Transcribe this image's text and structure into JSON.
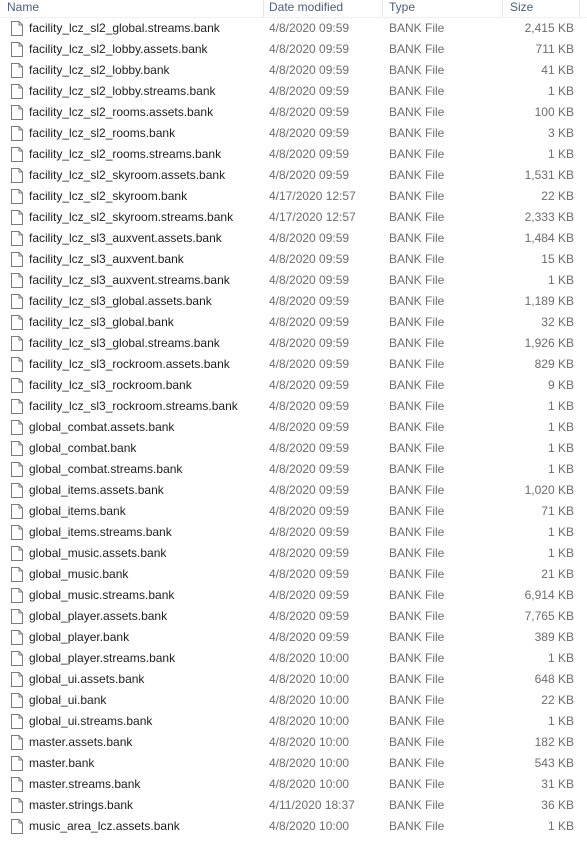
{
  "columns": {
    "name": "Name",
    "date": "Date modified",
    "type": "Type",
    "size": "Size"
  },
  "icons": {
    "file": "file-icon"
  },
  "files": [
    {
      "name": "facility_lcz_sl2_global.streams.bank",
      "date": "4/8/2020 09:59",
      "type": "BANK File",
      "size": "2,415 KB"
    },
    {
      "name": "facility_lcz_sl2_lobby.assets.bank",
      "date": "4/8/2020 09:59",
      "type": "BANK File",
      "size": "711 KB"
    },
    {
      "name": "facility_lcz_sl2_lobby.bank",
      "date": "4/8/2020 09:59",
      "type": "BANK File",
      "size": "41 KB"
    },
    {
      "name": "facility_lcz_sl2_lobby.streams.bank",
      "date": "4/8/2020 09:59",
      "type": "BANK File",
      "size": "1 KB"
    },
    {
      "name": "facility_lcz_sl2_rooms.assets.bank",
      "date": "4/8/2020 09:59",
      "type": "BANK File",
      "size": "100 KB"
    },
    {
      "name": "facility_lcz_sl2_rooms.bank",
      "date": "4/8/2020 09:59",
      "type": "BANK File",
      "size": "3 KB"
    },
    {
      "name": "facility_lcz_sl2_rooms.streams.bank",
      "date": "4/8/2020 09:59",
      "type": "BANK File",
      "size": "1 KB"
    },
    {
      "name": "facility_lcz_sl2_skyroom.assets.bank",
      "date": "4/8/2020 09:59",
      "type": "BANK File",
      "size": "1,531 KB"
    },
    {
      "name": "facility_lcz_sl2_skyroom.bank",
      "date": "4/17/2020 12:57",
      "type": "BANK File",
      "size": "22 KB"
    },
    {
      "name": "facility_lcz_sl2_skyroom.streams.bank",
      "date": "4/17/2020 12:57",
      "type": "BANK File",
      "size": "2,333 KB"
    },
    {
      "name": "facility_lcz_sl3_auxvent.assets.bank",
      "date": "4/8/2020 09:59",
      "type": "BANK File",
      "size": "1,484 KB"
    },
    {
      "name": "facility_lcz_sl3_auxvent.bank",
      "date": "4/8/2020 09:59",
      "type": "BANK File",
      "size": "15 KB"
    },
    {
      "name": "facility_lcz_sl3_auxvent.streams.bank",
      "date": "4/8/2020 09:59",
      "type": "BANK File",
      "size": "1 KB"
    },
    {
      "name": "facility_lcz_sl3_global.assets.bank",
      "date": "4/8/2020 09:59",
      "type": "BANK File",
      "size": "1,189 KB"
    },
    {
      "name": "facility_lcz_sl3_global.bank",
      "date": "4/8/2020 09:59",
      "type": "BANK File",
      "size": "32 KB"
    },
    {
      "name": "facility_lcz_sl3_global.streams.bank",
      "date": "4/8/2020 09:59",
      "type": "BANK File",
      "size": "1,926 KB"
    },
    {
      "name": "facility_lcz_sl3_rockroom.assets.bank",
      "date": "4/8/2020 09:59",
      "type": "BANK File",
      "size": "829 KB"
    },
    {
      "name": "facility_lcz_sl3_rockroom.bank",
      "date": "4/8/2020 09:59",
      "type": "BANK File",
      "size": "9 KB"
    },
    {
      "name": "facility_lcz_sl3_rockroom.streams.bank",
      "date": "4/8/2020 09:59",
      "type": "BANK File",
      "size": "1 KB"
    },
    {
      "name": "global_combat.assets.bank",
      "date": "4/8/2020 09:59",
      "type": "BANK File",
      "size": "1 KB"
    },
    {
      "name": "global_combat.bank",
      "date": "4/8/2020 09:59",
      "type": "BANK File",
      "size": "1 KB"
    },
    {
      "name": "global_combat.streams.bank",
      "date": "4/8/2020 09:59",
      "type": "BANK File",
      "size": "1 KB"
    },
    {
      "name": "global_items.assets.bank",
      "date": "4/8/2020 09:59",
      "type": "BANK File",
      "size": "1,020 KB"
    },
    {
      "name": "global_items.bank",
      "date": "4/8/2020 09:59",
      "type": "BANK File",
      "size": "71 KB"
    },
    {
      "name": "global_items.streams.bank",
      "date": "4/8/2020 09:59",
      "type": "BANK File",
      "size": "1 KB"
    },
    {
      "name": "global_music.assets.bank",
      "date": "4/8/2020 09:59",
      "type": "BANK File",
      "size": "1 KB"
    },
    {
      "name": "global_music.bank",
      "date": "4/8/2020 09:59",
      "type": "BANK File",
      "size": "21 KB"
    },
    {
      "name": "global_music.streams.bank",
      "date": "4/8/2020 09:59",
      "type": "BANK File",
      "size": "6,914 KB"
    },
    {
      "name": "global_player.assets.bank",
      "date": "4/8/2020 09:59",
      "type": "BANK File",
      "size": "7,765 KB"
    },
    {
      "name": "global_player.bank",
      "date": "4/8/2020 09:59",
      "type": "BANK File",
      "size": "389 KB"
    },
    {
      "name": "global_player.streams.bank",
      "date": "4/8/2020 10:00",
      "type": "BANK File",
      "size": "1 KB"
    },
    {
      "name": "global_ui.assets.bank",
      "date": "4/8/2020 10:00",
      "type": "BANK File",
      "size": "648 KB"
    },
    {
      "name": "global_ui.bank",
      "date": "4/8/2020 10:00",
      "type": "BANK File",
      "size": "22 KB"
    },
    {
      "name": "global_ui.streams.bank",
      "date": "4/8/2020 10:00",
      "type": "BANK File",
      "size": "1 KB"
    },
    {
      "name": "master.assets.bank",
      "date": "4/8/2020 10:00",
      "type": "BANK File",
      "size": "182 KB"
    },
    {
      "name": "master.bank",
      "date": "4/8/2020 10:00",
      "type": "BANK File",
      "size": "543 KB"
    },
    {
      "name": "master.streams.bank",
      "date": "4/8/2020 10:00",
      "type": "BANK File",
      "size": "31 KB"
    },
    {
      "name": "master.strings.bank",
      "date": "4/11/2020 18:37",
      "type": "BANK File",
      "size": "36 KB"
    },
    {
      "name": "music_area_lcz.assets.bank",
      "date": "4/8/2020 10:00",
      "type": "BANK File",
      "size": "1 KB"
    }
  ]
}
